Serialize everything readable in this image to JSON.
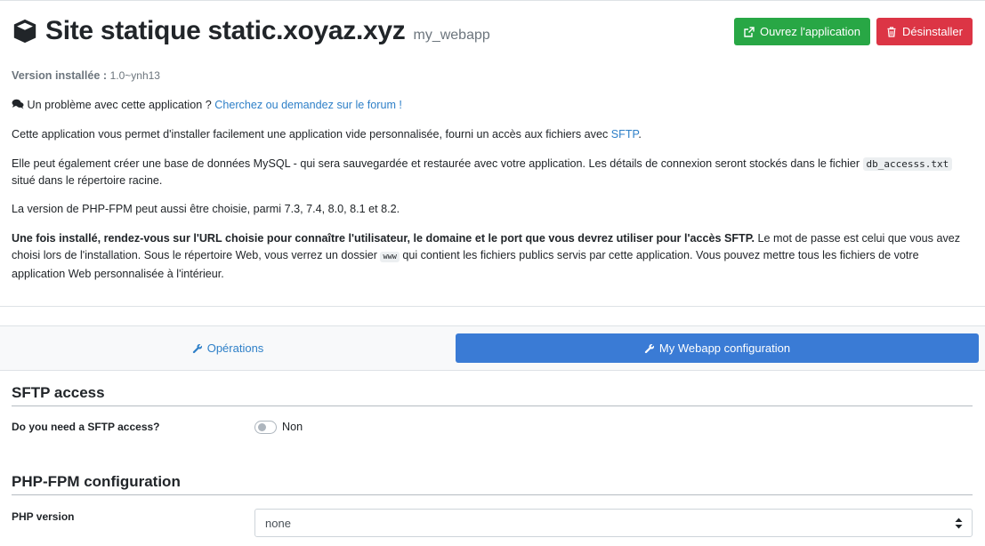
{
  "header": {
    "title": "Site statique static.xoyaz.xyz",
    "app_id": "my_webapp",
    "open_button": "Ouvrez l'application",
    "uninstall_button": "Désinstaller"
  },
  "version": {
    "label": "Version installée :",
    "value": "1.0~ynh13"
  },
  "forum": {
    "text": "Un problème avec cette application ?",
    "link": "Cherchez ou demandez sur le forum !"
  },
  "description": {
    "p1_text": "Cette application vous permet d'installer facilement une application vide personnalisée, fourni un accès aux fichiers avec",
    "p1_link": "SFTP",
    "p1_end": ".",
    "p2_text": "Elle peut également créer une base de données MySQL - qui sera sauvegardée et restaurée avec votre application. Les détails de connexion seront stockés dans le fichier",
    "p2_code": "db_accesss.txt",
    "p2_end": "situé dans le répertoire racine.",
    "p3": "La version de PHP-FPM peut aussi être choisie, parmi 7.3, 7.4, 8.0, 8.1 et 8.2.",
    "p4_bold": "Une fois installé, rendez-vous sur l'URL choisie pour connaître l'utilisateur, le domaine et le port que vous devrez utiliser pour l'accès SFTP.",
    "p4_text": "Le mot de passe est celui que vous avez choisi lors de l'installation. Sous le répertoire Web, vous verrez un dossier",
    "p4_code": "www",
    "p4_end": "qui contient les fichiers publics servis par cette application. Vous pouvez mettre tous les fichiers de votre application Web personnalisée à l'intérieur."
  },
  "tabs": {
    "operations": "Opérations",
    "config": "My Webapp configuration"
  },
  "sftp": {
    "title": "SFTP access",
    "question": "Do you need a SFTP access?",
    "toggle_value": "Non",
    "enabled": false
  },
  "php": {
    "title": "PHP-FPM configuration",
    "label": "PHP version",
    "selected": "none"
  },
  "colors": {
    "success": "#28a745",
    "danger": "#dc3545",
    "primary": "#3a7bd5",
    "link": "#2f80c8"
  },
  "icons": [
    "cube-icon",
    "external-link-icon",
    "trash-icon",
    "comments-icon",
    "wrench-icon",
    "sort-arrows-icon"
  ]
}
